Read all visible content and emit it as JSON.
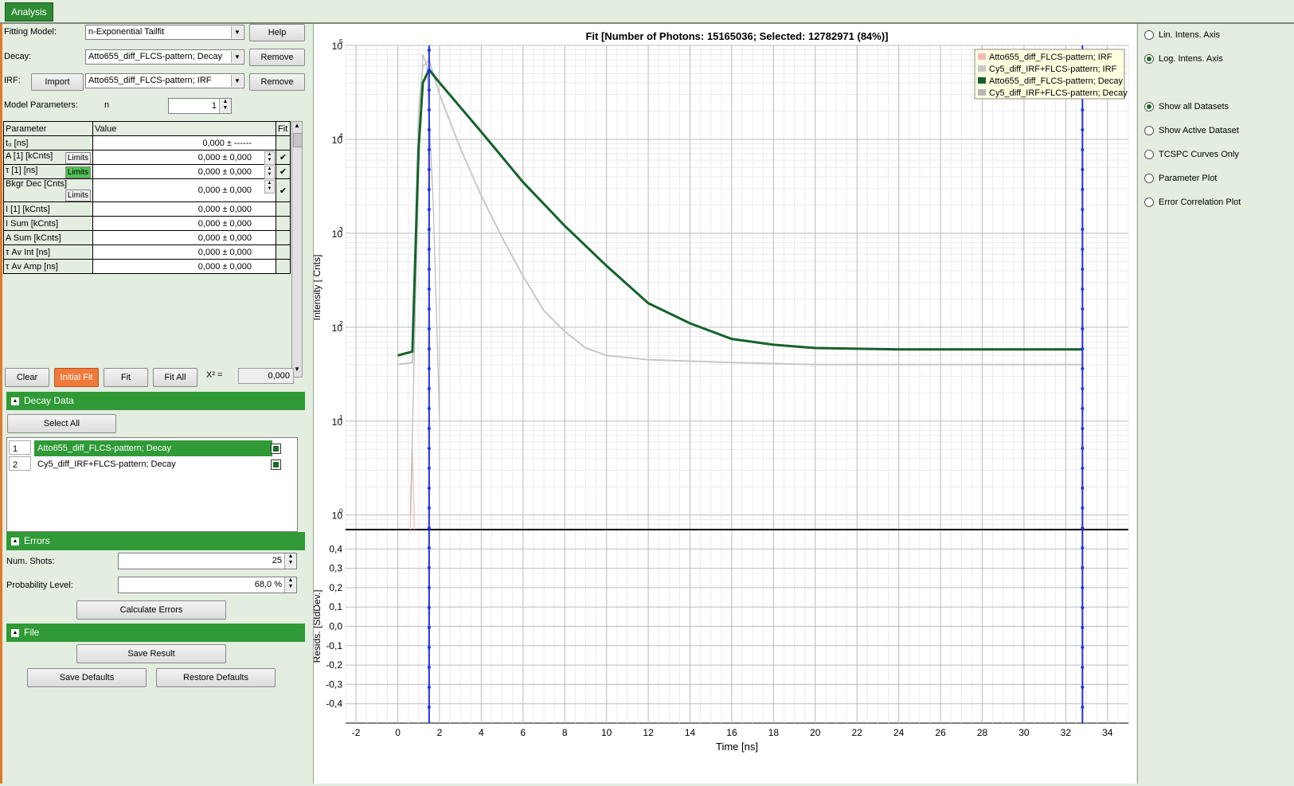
{
  "tabs": {
    "analysis": "Analysis"
  },
  "fit_model": {
    "label": "Fitting Model:",
    "value": "n-Exponential Tailfit",
    "help": "Help"
  },
  "decay": {
    "label": "Decay:",
    "value": "Atto655_diff_FLCS-pattern; Decay",
    "remove": "Remove"
  },
  "irf": {
    "label": "IRF:",
    "import": "Import",
    "value": "Atto655_diff_FLCS-pattern; IRF",
    "remove": "Remove"
  },
  "model_params": {
    "label": "Model Parameters:",
    "n_label": "n",
    "n_value": "1"
  },
  "param_table": {
    "headers": [
      "Parameter",
      "Value",
      "Fit"
    ],
    "limits_label": "Limits",
    "rows": [
      {
        "name": "t₀ [ns]",
        "value": "0,000 ± ------"
      },
      {
        "name": "A [1] [kCnts]",
        "value": "0,000 ± 0,000"
      },
      {
        "name": "τ [1] [ns]",
        "value": "0,000 ± 0,000"
      },
      {
        "name": "Bkgr Dec [Cnts]",
        "value": "0,000 ± 0,000"
      },
      {
        "name": "I [1] [kCnts]",
        "value": "0,000 ± 0,000"
      },
      {
        "name": "I Sum [kCnts]",
        "value": "0,000 ± 0,000"
      },
      {
        "name": "A Sum [kCnts]",
        "value": "0,000 ± 0,000"
      },
      {
        "name": "τ Av Int [ns]",
        "value": "0,000 ± 0,000"
      },
      {
        "name": "τ Av Amp [ns]",
        "value": "0,000 ± 0,000"
      }
    ]
  },
  "fit_buttons": {
    "clear": "Clear",
    "initial_fit": "Initial Fit",
    "fit": "Fit",
    "fit_all": "Fit All",
    "chi_label": "X² =",
    "chi_value": "0,000"
  },
  "decay_data": {
    "title": "Decay Data",
    "select_all": "Select All",
    "items": [
      {
        "num": "1",
        "name": "Atto655_diff_FLCS-pattern; Decay"
      },
      {
        "num": "2",
        "name": "Cy5_diff_IRF+FLCS-pattern; Decay"
      }
    ]
  },
  "errors": {
    "title": "Errors",
    "shots_label": "Num. Shots:",
    "shots_value": "25",
    "prob_label": "Probability Level:",
    "prob_value": "68,0 %",
    "calc": "Calculate Errors"
  },
  "file": {
    "title": "File",
    "save_result": "Save Result",
    "save_defaults": "Save Defaults",
    "restore_defaults": "Restore Defaults"
  },
  "right": {
    "lin": "Lin. Intens. Axis",
    "log": "Log. Intens. Axis",
    "show_all": "Show all Datasets",
    "show_active": "Show Active Dataset",
    "tcspc": "TCSPC Curves Only",
    "param_plot": "Parameter Plot",
    "err_corr": "Error Correlation Plot"
  },
  "colors": {
    "accent": "#2f9a36",
    "decay_green": "#14622b",
    "irf_gray": "#c8c8c8",
    "cursor_blue": "#1f2ff0",
    "irf_pink": "#f3b9b9"
  },
  "chart_data": {
    "type": "line",
    "title": "Fit [Number of Photons: 15165036; Selected: 12782971 (84%)]",
    "xlabel": "Time [ns]",
    "ylabel": "Intensity [ Cnts]",
    "resid_ylabel": "Resids. [StdDev.]",
    "xlim": [
      -2.5,
      35
    ],
    "ylim_log": [
      0.7,
      100000
    ],
    "resid_ylim": [
      -0.5,
      0.5
    ],
    "x_ticks": [
      "-2",
      "0",
      "2",
      "4",
      "6",
      "8",
      "10",
      "12",
      "14",
      "16",
      "18",
      "20",
      "22",
      "24",
      "26",
      "28",
      "30",
      "32",
      "34"
    ],
    "y_ticks": [
      "10¹",
      "10²",
      "10³",
      "10⁴",
      "10⁰"
    ],
    "y_ticks_full": [
      "10^5",
      "10^4",
      "10^3",
      "10^2",
      "10^1",
      "10^0"
    ],
    "y_tick_labels": [
      "10",
      "10",
      "10",
      "10",
      "10",
      "10"
    ],
    "y_tick_exps": [
      "5",
      "4",
      "3",
      "2",
      "1",
      "0"
    ],
    "resid_ticks": [
      "0,4",
      "0,3",
      "0,2",
      "0,1",
      "0,0",
      "-0,1",
      "-0,2",
      "-0,3",
      "-0,4"
    ],
    "cursors_ns": [
      1.5,
      32.8
    ],
    "legend": [
      "Atto655_diff_FLCS-pattern; IRF",
      "Cy5_diff_IRF+FLCS-pattern; IRF",
      "Atto655_diff_FLCS-pattern; Decay",
      "Cy5_diff_IRF+FLCS-pattern; Decay"
    ],
    "series": [
      {
        "name": "Atto655_diff_FLCS-pattern; Decay",
        "x": [
          0,
          0.7,
          0.8,
          1.0,
          1.2,
          1.5,
          2,
          4,
          6,
          8,
          10,
          12,
          14,
          16,
          18,
          20,
          24,
          28,
          32,
          32.8
        ],
        "y": [
          50,
          55,
          300,
          8000,
          40000,
          55000,
          40000,
          12000,
          3500,
          1200,
          450,
          180,
          110,
          75,
          65,
          60,
          58,
          58,
          58,
          58
        ]
      },
      {
        "name": "Cy5_diff_IRF+FLCS-pattern; Decay",
        "x": [
          0,
          0.7,
          0.8,
          1.0,
          1.2,
          1.5,
          2,
          3,
          4,
          5,
          6,
          7,
          8,
          9,
          10,
          12,
          16,
          20,
          26,
          32.8
        ],
        "y": [
          40,
          42,
          300,
          20000,
          60000,
          70000,
          30000,
          8000,
          2500,
          900,
          350,
          150,
          90,
          60,
          50,
          45,
          42,
          40,
          40,
          40
        ]
      },
      {
        "name": "Cy5_diff_IRF+FLCS-pattern; IRF",
        "x": [
          0.6,
          0.8,
          1.0,
          1.2,
          1.4,
          1.7,
          2.0
        ],
        "y": [
          1,
          60,
          5000,
          80000,
          60000,
          2000,
          10
        ]
      },
      {
        "name": "Atto655_diff_FLCS-pattern; IRF",
        "x": [
          0.6,
          0.7,
          0.8
        ],
        "y": [
          0.7,
          5,
          0.7
        ]
      }
    ]
  }
}
